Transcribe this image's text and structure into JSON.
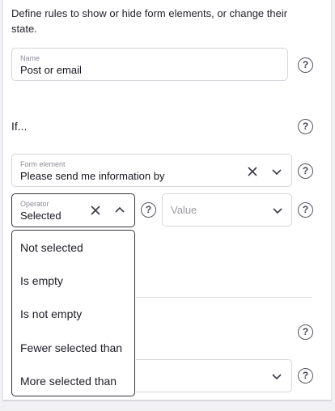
{
  "intro_text": "Define rules to show or hide form elements, or change their state.",
  "name_field": {
    "label": "Name",
    "value": "Post or email"
  },
  "if_heading": "If...",
  "form_element_field": {
    "label": "Form element",
    "value": "Please send me information by"
  },
  "operator_field": {
    "label": "Operator",
    "value": "Selected"
  },
  "value_field": {
    "placeholder": "Value"
  },
  "help_glyph": "?",
  "operator_options": [
    "Not selected",
    "Is empty",
    "Is not empty",
    "Fewer selected than",
    "More selected than"
  ],
  "icons": {
    "clear": "close-icon",
    "expand": "chevron-down-icon",
    "collapse": "chevron-up-icon",
    "help": "help-circle-icon"
  }
}
